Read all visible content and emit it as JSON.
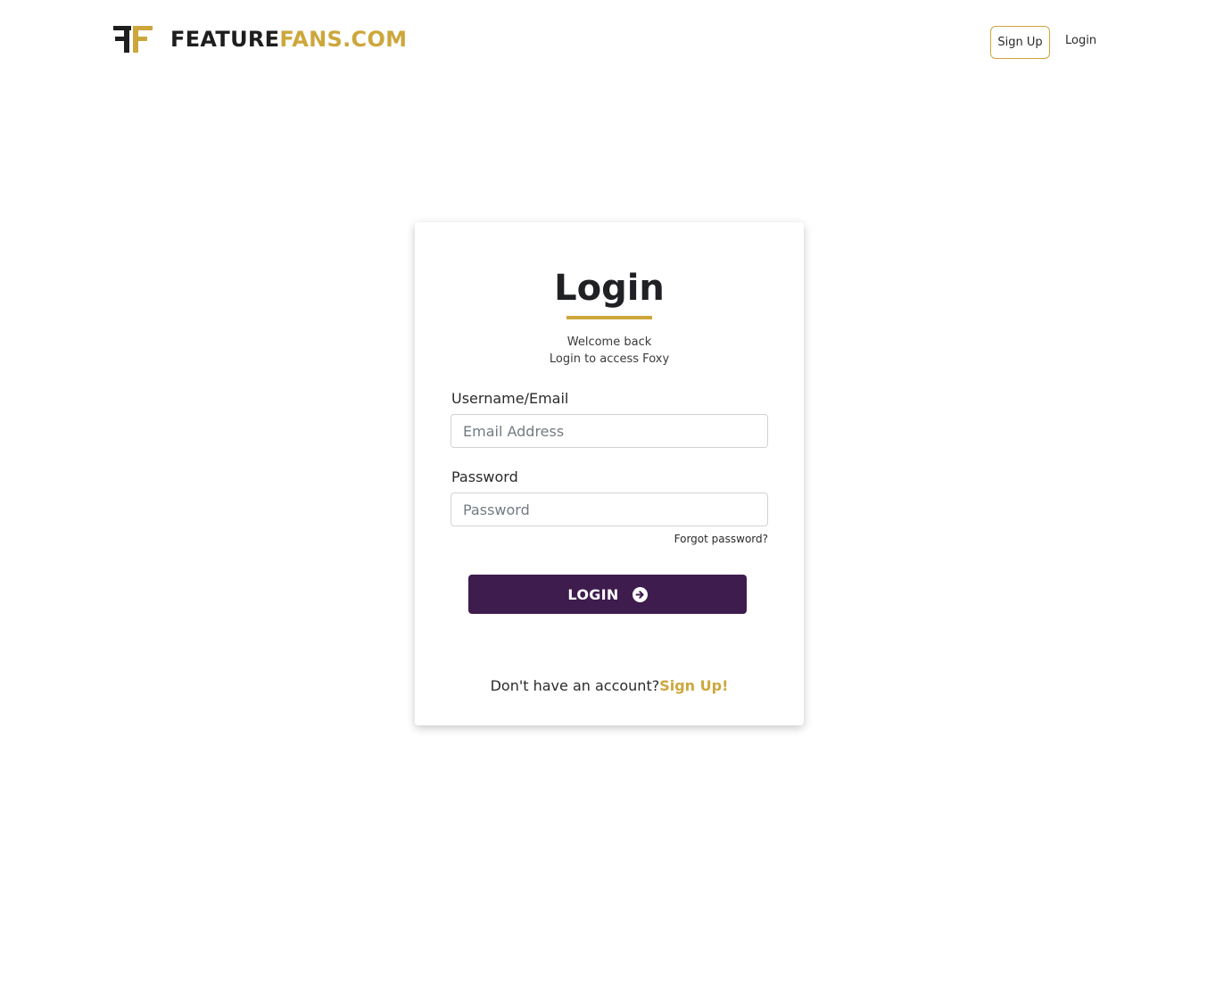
{
  "header": {
    "logo_word_1": "FEATURE",
    "logo_word_2": "FANS.COM",
    "signup_label": "Sign Up",
    "login_label": "Login"
  },
  "login_card": {
    "title": "Login",
    "subtitle_line_1": "Welcome back",
    "subtitle_line_2": "Login to access Foxy",
    "username_label": "Username/Email",
    "username_placeholder": "Email Address",
    "password_label": "Password",
    "password_placeholder": "Password",
    "forgot_password": "Forgot password?",
    "login_button": "LOGIN",
    "no_account_text": "Don't have an account?",
    "signup_link": "Sign Up!"
  },
  "colors": {
    "accent_gold": "#cda73c",
    "button_purple": "#3e1c4e",
    "text_dark": "#202124"
  },
  "icons": {
    "logo": "ff-logo-mark",
    "login_button": "arrow-circle-right-icon"
  }
}
